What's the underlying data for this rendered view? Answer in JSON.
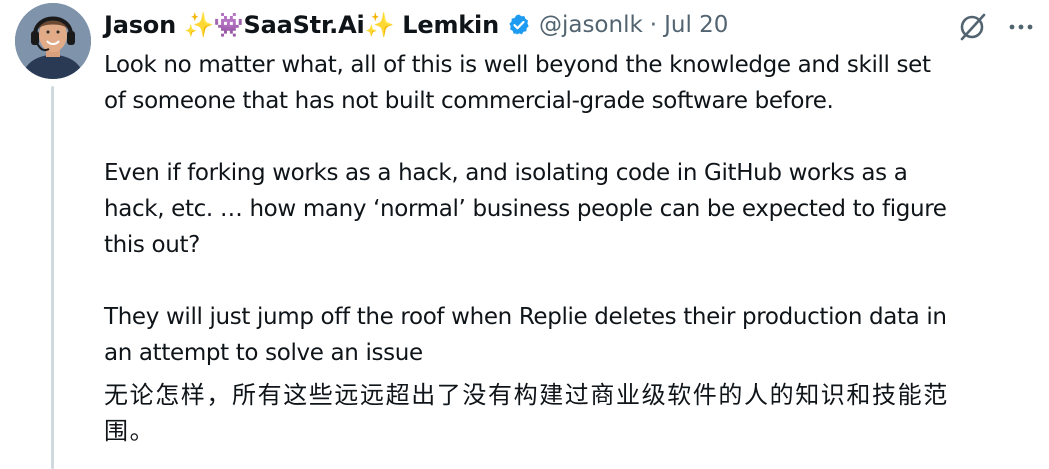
{
  "author": {
    "name": "Jason ✨👾SaaStr.Ai✨ Lemkin",
    "handle": "@jasonlk",
    "separator": "·",
    "date": "Jul 20",
    "verified_icon": "verified-badge-icon",
    "avatar_icon": "avatar"
  },
  "actions": {
    "grok_icon": "grok-icon",
    "more_icon": "more-icon"
  },
  "tweet": {
    "line1": "Look no matter what, all of this is well beyond the knowledge and skill set",
    "line2": "of someone that has not built commercial-grade software before.",
    "line3": "Even if forking works as a hack, and isolating code in GitHub works as a",
    "line4": "hack, etc. … how many ‘normal’ business people can be expected to figure",
    "line5": "this out?",
    "line6": "They will just jump off the roof when Replie deletes their production data in",
    "line7": "an attempt to solve an issue"
  },
  "translation": {
    "line1": "无论怎样，所有这些远远超出了没有构建过商业级软件的人的知识和技能范",
    "line2": "围。"
  },
  "colors": {
    "text": "#0f1419",
    "muted": "#536471",
    "verified": "#1d9bf0",
    "thread_line": "#cfd9de"
  }
}
